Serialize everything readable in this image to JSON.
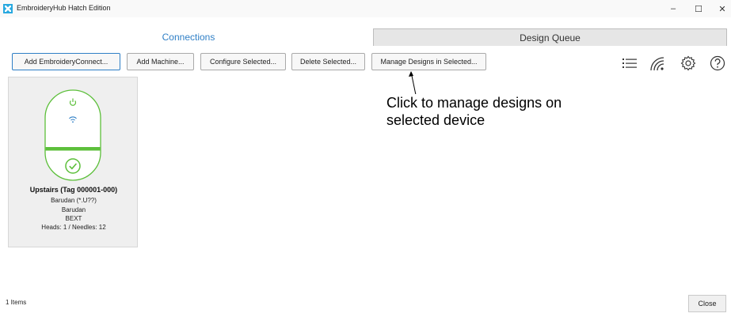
{
  "window": {
    "title": "EmbroideryHub Hatch Edition",
    "minimize_glyph": "–",
    "maximize_glyph": "☐",
    "close_glyph": "✕"
  },
  "tabs": [
    {
      "label": "Connections",
      "active": true
    },
    {
      "label": "Design Queue",
      "active": false
    }
  ],
  "toolbar": {
    "buttons": [
      {
        "label": "Add EmbroideryConnect..."
      },
      {
        "label": "Add Machine..."
      },
      {
        "label": "Configure Selected..."
      },
      {
        "label": "Delete Selected..."
      },
      {
        "label": "Manage Designs in Selected..."
      }
    ],
    "icons": [
      "list-view-icon",
      "wireless-signal-icon",
      "settings-gear-icon",
      "help-icon"
    ]
  },
  "device": {
    "name": "Upstairs (Tag 000001-000)",
    "machine": "Barudan (*.U??)",
    "brand": "Barudan",
    "format": "BEXT",
    "heads_needles": "Heads: 1 / Needles: 12",
    "icons": [
      "power-icon",
      "wifi-icon",
      "status-check-icon"
    ]
  },
  "callout": {
    "text": "Click to manage designs on selected device"
  },
  "footer": {
    "items_count": "1 Items",
    "close_label": "Close"
  },
  "colors": {
    "accent_blue": "#2f7fc6",
    "device_green": "#5cbf3a",
    "card_bg": "#efefef"
  }
}
